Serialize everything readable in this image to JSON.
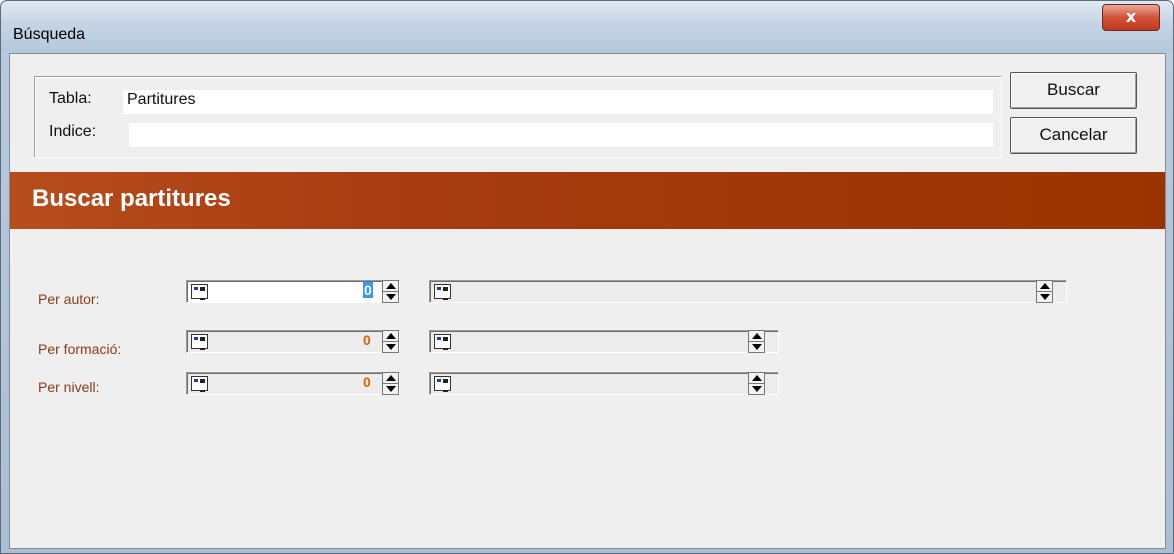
{
  "window": {
    "title": "Búsqueda",
    "close_symbol": "x"
  },
  "info": {
    "tabla_label": "Tabla:",
    "tabla_value": "Partitures",
    "indice_label": "Indice:",
    "indice_value": ""
  },
  "buttons": {
    "search": "Buscar",
    "cancel": "Cancelar"
  },
  "banner": {
    "title": "Buscar partitures"
  },
  "criteria": [
    {
      "label": "Per autor:",
      "count": "0",
      "count_selected": true
    },
    {
      "label": "Per formació:",
      "count": "0",
      "count_selected": false
    },
    {
      "label": "Per nivell:",
      "count": "0",
      "count_selected": false
    }
  ],
  "colors": {
    "banner": "#a63c10",
    "label_text": "#8a3a1a",
    "count_text": "#e0600a",
    "selection": "#3399ff"
  },
  "icons": [
    "close-icon",
    "pick-list-icon",
    "spin-up-icon",
    "spin-down-icon"
  ]
}
